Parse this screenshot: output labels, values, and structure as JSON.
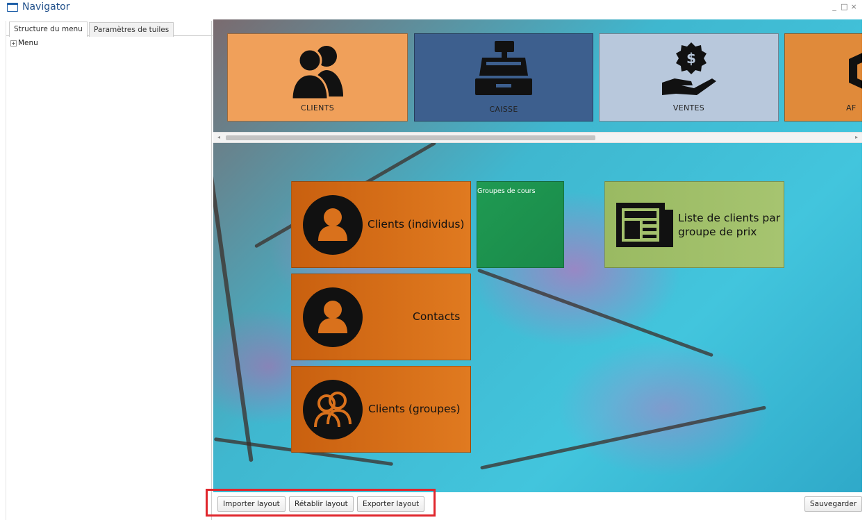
{
  "window": {
    "title": "Navigator",
    "controls": [
      "_",
      "□",
      "×"
    ]
  },
  "left_panel": {
    "tabs": [
      {
        "label": "Structure du menu",
        "active": true
      },
      {
        "label": "Paramètres de tuiles",
        "active": false
      }
    ],
    "tree": {
      "expander": "+",
      "root": "Menu"
    }
  },
  "top_tiles": [
    {
      "label": "CLIENTS",
      "icon": "users-icon",
      "color": "#f0a05a"
    },
    {
      "label": "CAISSE",
      "icon": "cash-register-icon",
      "color": "#3d5f8e"
    },
    {
      "label": "VENTES",
      "icon": "hand-money-icon",
      "color": "#b8c8dc"
    },
    {
      "label": "AF",
      "icon": "box-icon",
      "color": "#e08a3a"
    }
  ],
  "tiles": {
    "clients_individus": {
      "label": "Clients (individus)",
      "icon": "user-icon"
    },
    "groupes_de_cours": {
      "label": "Groupes de cours",
      "color": "#1f9a52"
    },
    "liste_clients": {
      "label_line1": "Liste de clients par",
      "label_line2": "groupe de prix",
      "icon": "newspaper-icon",
      "color": "#9cbd66"
    },
    "contacts": {
      "label": "Contacts",
      "icon": "user-icon"
    },
    "clients_groupes": {
      "label": "Clients (groupes)",
      "icon": "users-icon"
    }
  },
  "bottom_bar": {
    "import_label": "Importer layout",
    "reset_label": "Rétablir layout",
    "export_label": "Exporter layout",
    "save_label": "Sauvegarder"
  }
}
